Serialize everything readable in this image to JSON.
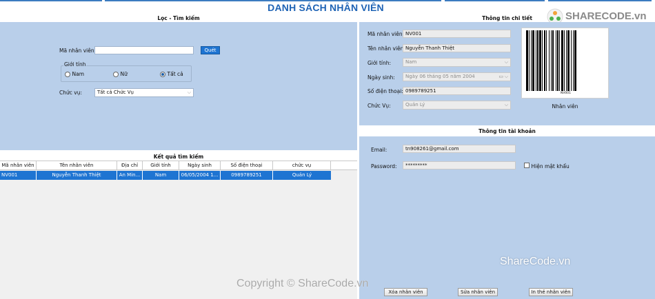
{
  "header": {
    "title": "DANH SÁCH NHÂN VIÊN"
  },
  "search_panel": {
    "title": "Lọc - Tìm kiếm",
    "employee_id_label": "Mã nhân viên:",
    "employee_id_value": "",
    "scan_button": "Quét",
    "gender_group_label": "Giới tính",
    "gender_options": [
      "Nam",
      "Nữ",
      "Tất cả"
    ],
    "gender_selected": "Tất cả",
    "position_label": "Chức vụ:",
    "position_value": "Tất cả Chức Vụ"
  },
  "results": {
    "title": "Kết quả tìm kiếm",
    "columns": [
      "Mã nhân viên",
      "Tên nhân viên",
      "Địa chỉ",
      "Giới tính",
      "Ngày sinh",
      "Số điện thoại",
      "chức vụ"
    ],
    "rows": [
      [
        "NV001",
        "Nguyễn Thanh Thiệt",
        "An Min...",
        "Nam",
        "06/05/2004 1...",
        "0989789251",
        "Quản Lý"
      ]
    ]
  },
  "detail_panel": {
    "title": "Thông tin chi tiết",
    "fields": {
      "id_label": "Mã nhân viên:",
      "id_value": "NV001",
      "name_label": "Tên nhân viên:",
      "name_value": "Nguyễn Thanh Thiệt",
      "gender_label": "Giới tính:",
      "gender_value": "Nam",
      "dob_label": "Ngày sinh:",
      "dob_value": "Ngày 06 tháng 05 năm 2004",
      "phone_label": "Số điện thoại:",
      "phone_value": "0989789251",
      "position_label": "Chức Vụ:",
      "position_value": "Quản Lý"
    },
    "barcode_text": "NV001",
    "barcode_caption": "Nhân viên"
  },
  "account_panel": {
    "title": "Thông tin tài khoản",
    "email_label": "Email:",
    "email_value": "tn908261@gmail.com",
    "password_label": "Password:",
    "password_value": "*********",
    "show_password_label": "Hiện mật khẩu"
  },
  "actions": {
    "delete": "Xóa nhân viên",
    "edit": "Sửa nhân viên",
    "print": "In thẻ nhân viên"
  },
  "watermarks": {
    "logo_text": "SHARECODE.vn",
    "mid": "ShareCode.vn",
    "copyright": "Copyright © ShareCode.vn"
  },
  "colors": {
    "accent": "#1e74d2",
    "panel": "#b9cfea",
    "title": "#1e63b5"
  }
}
